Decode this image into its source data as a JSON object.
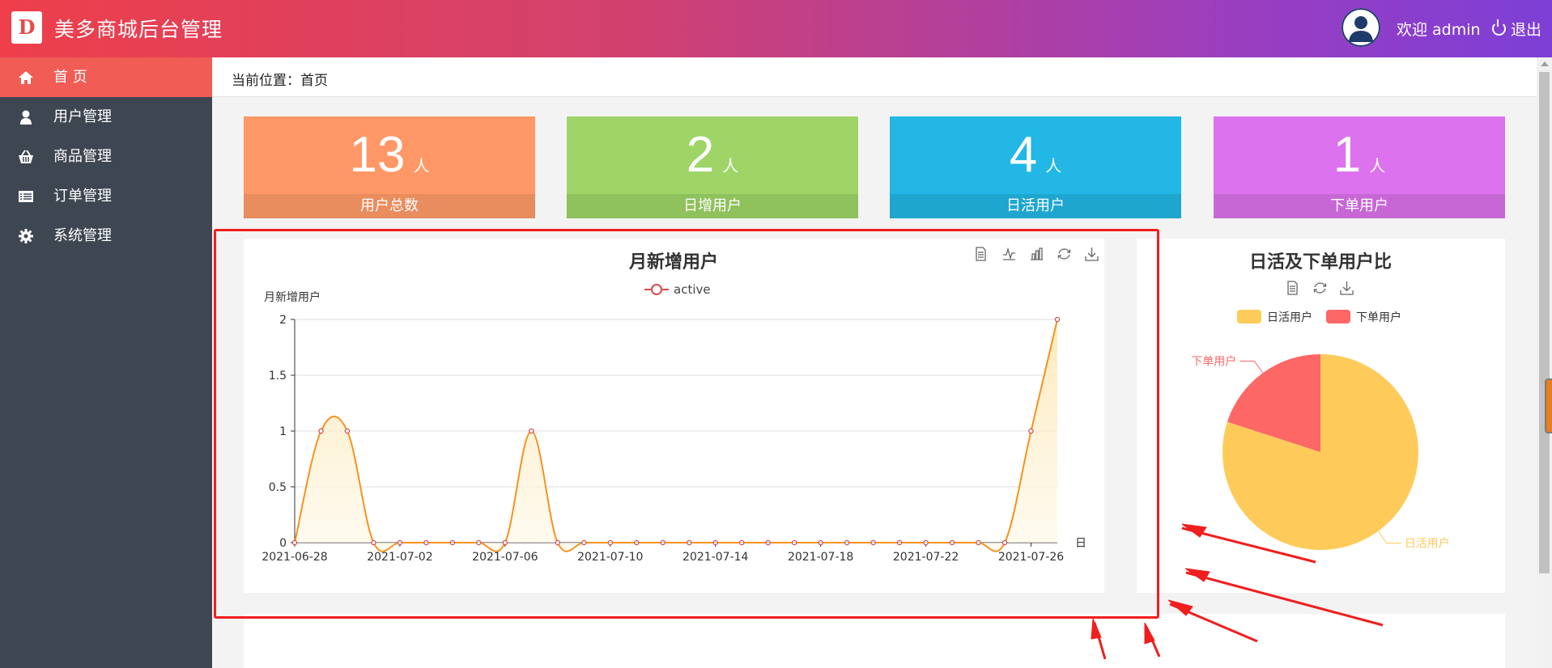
{
  "header": {
    "logo_text": "D",
    "title": "美多商城后台管理",
    "welcome": "欢迎 admin",
    "logout": "退出"
  },
  "sidebar": {
    "items": [
      {
        "label": "首 页",
        "icon": "home-icon",
        "active": true
      },
      {
        "label": "用户管理",
        "icon": "user-icon",
        "active": false
      },
      {
        "label": "商品管理",
        "icon": "basket-icon",
        "active": false
      },
      {
        "label": "订单管理",
        "icon": "list-icon",
        "active": false
      },
      {
        "label": "系统管理",
        "icon": "gear-icon",
        "active": false
      }
    ]
  },
  "breadcrumb": "当前位置：首页",
  "stats": [
    {
      "value": "13",
      "unit": "人",
      "caption": "用户总数",
      "color": "#ff9866",
      "bar": "#e98c5e"
    },
    {
      "value": "2",
      "unit": "人",
      "caption": "日增用户",
      "color": "#9fd567",
      "bar": "#8fc15d"
    },
    {
      "value": "4",
      "unit": "人",
      "caption": "日活用户",
      "color": "#22b7e5",
      "bar": "#1fa6cf"
    },
    {
      "value": "1",
      "unit": "人",
      "caption": "下单用户",
      "color": "#dd72ee",
      "bar": "#c767d6"
    }
  ],
  "chart_data": [
    {
      "type": "area",
      "title": "月新增用户",
      "ylabel": "月新增用户",
      "xlabel": "日",
      "ylim": [
        0,
        2
      ],
      "yticks": [
        "0",
        "0.5",
        "1",
        "1.5",
        "2"
      ],
      "xtick_labels": [
        "2021-06-28",
        "2021-07-02",
        "2021-07-06",
        "2021-07-10",
        "2021-07-14",
        "2021-07-18",
        "2021-07-22",
        "2021-07-26"
      ],
      "legend": "active",
      "grid": true,
      "toolbox": [
        "data-view-icon",
        "line-chart-icon",
        "bar-chart-icon",
        "refresh-icon",
        "download-icon"
      ],
      "x": [
        "2021-06-28",
        "2021-06-29",
        "2021-06-30",
        "2021-07-01",
        "2021-07-02",
        "2021-07-03",
        "2021-07-04",
        "2021-07-05",
        "2021-07-06",
        "2021-07-07",
        "2021-07-08",
        "2021-07-09",
        "2021-07-10",
        "2021-07-11",
        "2021-07-12",
        "2021-07-13",
        "2021-07-14",
        "2021-07-15",
        "2021-07-16",
        "2021-07-17",
        "2021-07-18",
        "2021-07-19",
        "2021-07-20",
        "2021-07-21",
        "2021-07-22",
        "2021-07-23",
        "2021-07-24",
        "2021-07-25",
        "2021-07-26",
        "2021-07-27"
      ],
      "series": [
        {
          "name": "active",
          "values": [
            0,
            1,
            1,
            0,
            0,
            0,
            0,
            0,
            0,
            1,
            0,
            0,
            0,
            0,
            0,
            0,
            0,
            0,
            0,
            0,
            0,
            0,
            0,
            0,
            0,
            0,
            0,
            0,
            1,
            2
          ],
          "color": "#f7921e"
        }
      ]
    },
    {
      "type": "pie",
      "title": "日活及下单用户比",
      "legend": [
        "日活用户",
        "下单用户"
      ],
      "toolbox": [
        "data-view-icon",
        "refresh-icon",
        "download-icon"
      ],
      "slices": [
        {
          "name": "日活用户",
          "value": 4,
          "color": "#fecb5b"
        },
        {
          "name": "下单用户",
          "value": 1,
          "color": "#fd6766"
        }
      ]
    }
  ]
}
